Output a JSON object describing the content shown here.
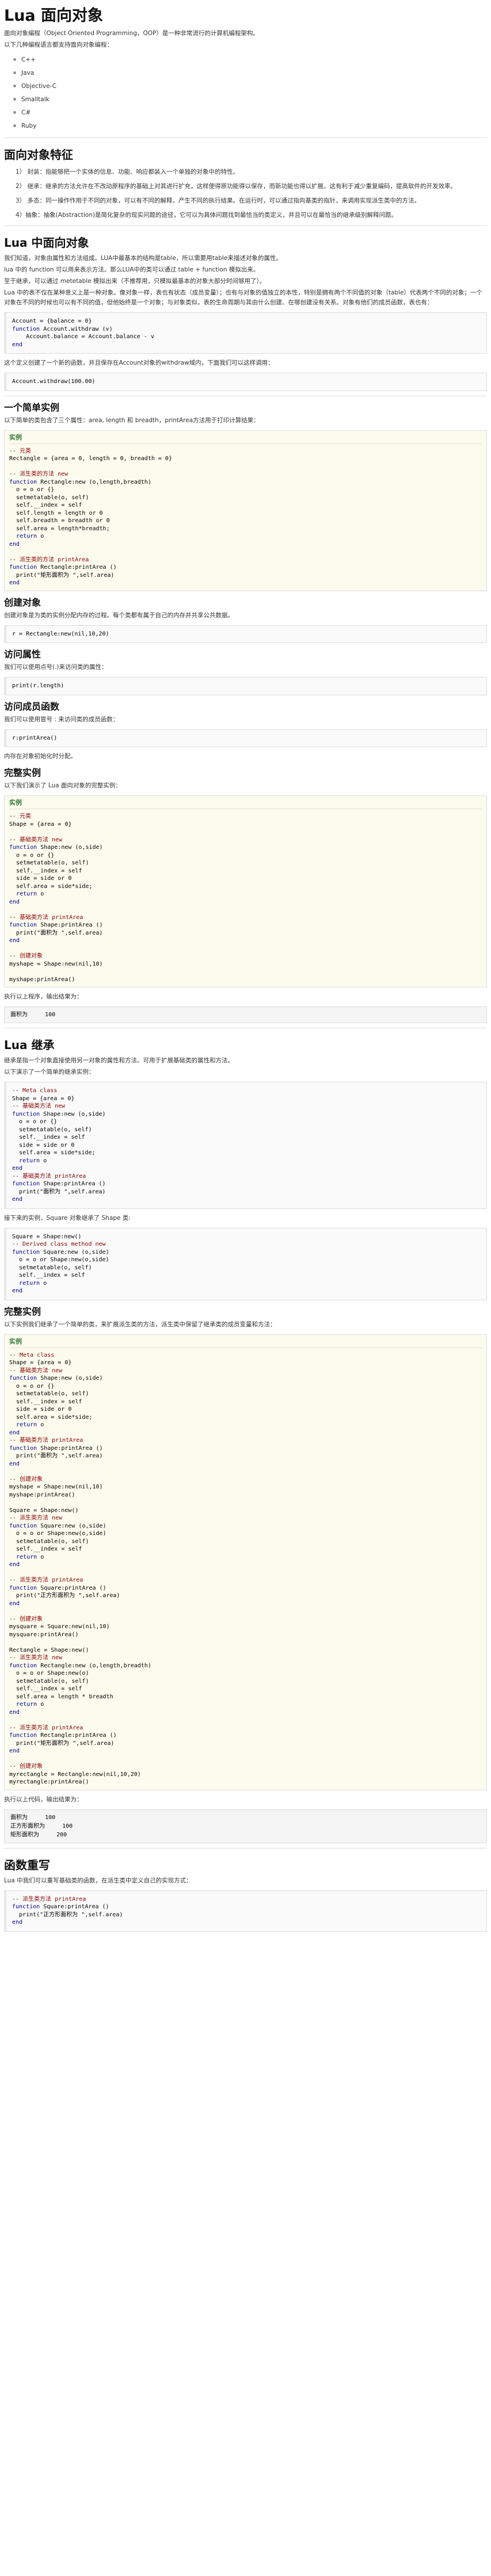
{
  "sections": {
    "intro": {
      "title": "Lua 面向对象",
      "p1": "面向对象编程（Object Oriented Programming，OOP）是一种非常流行的计算机编程架构。",
      "p2": "以下几种编程语言都支持面向对象编程：",
      "langs": [
        "C++",
        "Java",
        "Objective-C",
        "Smalltalk",
        "C#",
        "Ruby"
      ]
    },
    "features": {
      "title": "面向对象特征",
      "items": [
        "1） 封装：指能够把一个实体的信息、功能、响应都装入一个单独的对象中的特性。",
        "2） 继承：继承的方法允许在不改动原程序的基础上对其进行扩充，这样使得原功能得以保存，而新功能也得以扩展。这有利于减少重复编码，提高软件的开发效率。",
        "3） 多态：同一操作作用于不同的对象，可以有不同的解释，产生不同的执行结果。在运行时，可以通过指向基类的指针，来调用实现派生类中的方法。",
        "4）抽象：抽象(Abstraction)是简化复杂的现实问题的途径，它可以为具体问题找到最恰当的类定义，并且可以在最恰当的继承级别解释问题。"
      ]
    },
    "oop": {
      "title": "Lua 中面向对象",
      "p1": "我们知道，对象由属性和方法组成。LUA中最基本的结构是table，所以需要用table来描述对象的属性。",
      "p2": "lua 中的 function 可以用来表示方法。那么LUA中的类可以通过 table + function 模拟出来。",
      "p3": "至于继承，可以通过 metetable 模拟出来（不推荐用，只模拟最基本的对象大部分时间够用了）。",
      "p4": "Lua 中的表不仅在某种意义上是一种对象。像对象一样，表也有状态（成员变量）；也有与对象的值独立的本性，特别是拥有两个不同值的对象（table）代表两个不同的对象；一个对象在不同的时候也可以有不同的值，但他始终是一个对象；与对象类似，表的生命周期与其由什么创建、在哪创建没有关系。对象有他们的成员函数，表也有：",
      "code1": "Account = {balance = 0}\nfunction Account.withdraw (v)\n    Account.balance = Account.balance - v\nend",
      "p5": "这个定义创建了一个新的函数，并且保存在Account对象的withdraw域内，下面我们可以这样调用：",
      "code2": "Account.withdraw(100.00)"
    },
    "simple": {
      "title": "一个简单实例",
      "p1": "以下简单的类包含了三个属性：area, length 和 breadth，printArea方法用于打印计算结果：",
      "example_label": "实例",
      "code": "-- 元类\nRectangle = {area = 0, length = 0, breadth = 0}\n\n-- 派生类的方法 new\nfunction Rectangle:new (o,length,breadth)\n  o = o or {}\n  setmetatable(o, self)\n  self.__index = self\n  self.length = length or 0\n  self.breadth = breadth or 0\n  self.area = length*breadth;\n  return o\nend\n\n-- 派生类的方法 printArea\nfunction Rectangle:printArea ()\n  print(\"矩形面积为 \",self.area)\nend"
    },
    "create": {
      "title": "创建对象",
      "p1": "创建对象是为类的实例分配内存的过程。每个类都有属于自己的内存并共享公共数据。",
      "code": "r = Rectangle:new(nil,10,20)"
    },
    "access": {
      "title": "访问属性",
      "p1": "我们可以使用点号(.)来访问类的属性：",
      "code": "print(r.length)"
    },
    "member": {
      "title": "访问成员函数",
      "p1": "我们可以使用冒号 : 来访问类的成员函数：",
      "code": "r:printArea()",
      "p2": "内存在对象初始化时分配。"
    },
    "complete": {
      "title": "完整实例",
      "p1": "以下我们演示了 Lua 面向对象的完整实例：",
      "example_label": "实例",
      "code": "-- 元类\nShape = {area = 0}\n\n-- 基础类方法 new\nfunction Shape:new (o,side)\n  o = o or {}\n  setmetatable(o, self)\n  self.__index = self\n  side = side or 0\n  self.area = side*side;\n  return o\nend\n\n-- 基础类方法 printArea\nfunction Shape:printArea ()\n  print(\"面积为 \",self.area)\nend\n\n-- 创建对象\nmyshape = Shape:new(nil,10)\n\nmyshape:printArea()",
      "p2": "执行以上程序，输出结果为：",
      "output": "面积为     100"
    },
    "inherit": {
      "title": "Lua 继承",
      "p1": "继承是指一个对象直接使用另一对象的属性和方法。可用于扩展基础类的属性和方法。",
      "p2": "以下演示了一个简单的继承实例：",
      "code1": "-- Meta class\nShape = {area = 0}\n-- 基础类方法 new\nfunction Shape:new (o,side)\n  o = o or {}\n  setmetatable(o, self)\n  self.__index = self\n  side = side or 0\n  self.area = side*side;\n  return o\nend\n-- 基础类方法 printArea\nfunction Shape:printArea ()\n  print(\"面积为 \",self.area)\nend",
      "p3": "接下来的实例，Square 对象继承了 Shape 类:",
      "code2": "Square = Shape:new()\n-- Derived class method new\nfunction Square:new (o,side)\n  o = o or Shape:new(o,side)\n  setmetatable(o, self)\n  self.__index = self\n  return o\nend"
    },
    "complete2": {
      "title": "完整实例",
      "p1": "以下实例我们继承了一个简单的类，来扩展派生类的方法，派生类中保留了继承类的成员变量和方法：",
      "example_label": "实例",
      "code": "-- Meta class\nShape = {area = 0}\n-- 基础类方法 new\nfunction Shape:new (o,side)\n  o = o or {}\n  setmetatable(o, self)\n  self.__index = self\n  side = side or 0\n  self.area = side*side;\n  return o\nend\n-- 基础类方法 printArea\nfunction Shape:printArea ()\n  print(\"面积为 \",self.area)\nend\n\n-- 创建对象\nmyshape = Shape:new(nil,10)\nmyshape:printArea()\n\nSquare = Shape:new()\n-- 派生类方法 new\nfunction Square:new (o,side)\n  o = o or Shape:new(o,side)\n  setmetatable(o, self)\n  self.__index = self\n  return o\nend\n\n-- 派生类方法 printArea\nfunction Square:printArea ()\n  print(\"正方形面积为 \",self.area)\nend\n\n-- 创建对象\nmysquare = Square:new(nil,10)\nmysquare:printArea()\n\nRectangle = Shape:new()\n-- 派生类方法 new\nfunction Rectangle:new (o,length,breadth)\n  o = o or Shape:new(o)\n  setmetatable(o, self)\n  self.__index = self\n  self.area = length * breadth\n  return o\nend\n\n-- 派生类方法 printArea\nfunction Rectangle:printArea ()\n  print(\"矩形面积为 \",self.area)\nend\n\n-- 创建对象\nmyrectangle = Rectangle:new(nil,10,20)\nmyrectangle:printArea()",
      "p2": "执行以上代码，输出结果为：",
      "output": "面积为     100\n正方形面积为     100\n矩形面积为     200"
    },
    "override": {
      "title": "函数重写",
      "p1": "Lua 中我们可以重写基础类的函数，在派生类中定义自己的实现方式：",
      "code": "-- 派生类方法 printArea\nfunction Square:printArea ()\n  print(\"正方形面积为 \",self.area)\nend"
    }
  }
}
